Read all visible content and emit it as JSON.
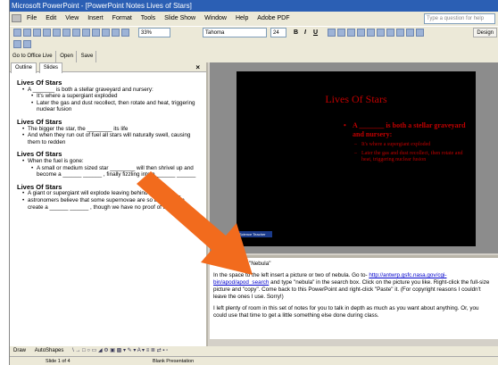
{
  "window": {
    "title": "Microsoft PowerPoint - [PowerPoint Notes Lives of Stars]"
  },
  "menu": {
    "items": [
      "File",
      "Edit",
      "View",
      "Insert",
      "Format",
      "Tools",
      "Slide Show",
      "Window",
      "Help",
      "Adobe PDF"
    ],
    "help_placeholder": "Type a question for help"
  },
  "toolbar": {
    "zoom": "33%",
    "font_name": "Tahoma",
    "font_size": "24",
    "bold": "B",
    "italic": "I",
    "underline": "U",
    "design": "Design",
    "office_live": "Go to Office Live",
    "open": "Open",
    "save": "Save"
  },
  "outline": {
    "tabs": [
      "Outline",
      "Slides"
    ],
    "close": "×",
    "slides": [
      {
        "title": "Lives Of Stars",
        "bullets": [
          {
            "text": "A _______ is both a stellar graveyard and nursery:",
            "subs": [
              "It's where a supergiant exploded",
              "Later the gas and dust recollect, then rotate and heat, triggering nuclear fusion"
            ]
          }
        ]
      },
      {
        "title": "Lives Of Stars",
        "bullets": [
          {
            "text": "The bigger the star, the ________ its life",
            "subs": []
          },
          {
            "text": "And when they run out of fuel all stars will naturally swell, causing them to redden",
            "subs": []
          }
        ]
      },
      {
        "title": "Lives Of Stars",
        "bullets": [
          {
            "text": "When the fuel is gone:",
            "subs": [
              "A small or medium sized star ________ will then shrivel up and become a ______ ______ , finally fizzling into a ______ ______"
            ]
          }
        ]
      },
      {
        "title": "Lives Of Stars",
        "bullets": [
          {
            "text": "A giant or supergiant will explode leaving behind a ____ ____",
            "subs": []
          },
          {
            "text": "astronomers believe that some supernovae are so big they can create a ______ ______ , though we have no proof of them",
            "subs": []
          }
        ]
      }
    ]
  },
  "slide": {
    "title": "Lives Of Stars",
    "bullet": "A _______ is both a stellar graveyard and nursery:",
    "subs": [
      "It's where a supergiant exploded",
      "Later the gas and dust recollect, then rotate and heat, triggering nuclear fusion"
    ],
    "logo_text": "Science Teacher"
  },
  "notes": {
    "heading": "\"Nebula\"",
    "p1_before": "In the space to the left insert a picture or two of nebula.  Go to- ",
    "link": "http://antwrp.gsfc.nasa.gov/cgi-bin/apod/apod_search",
    "p1_after": " and type \"nebula\" in the search box.  Click on the picture you like.  Right-click the full-size picture and \"copy\".  Come back to this PowerPoint and right-click \"Paste\" it.  (For copyright reasons I couldn't leave the ones I use.  Sorry!)",
    "p2": "I left plenty of room in this set of notes for you to talk in depth as much as you want about anything. Or, you could use that time to get a little something else done during class."
  },
  "drawbar": {
    "draw": "Draw",
    "autoshapes": "AutoShapes"
  },
  "status": {
    "slide": "Slide 1 of 4",
    "template": "Blank Presentation"
  },
  "colors": {
    "slide_bg": "#000000",
    "slide_text": "#c00000",
    "arrow": "#f26b1d"
  }
}
